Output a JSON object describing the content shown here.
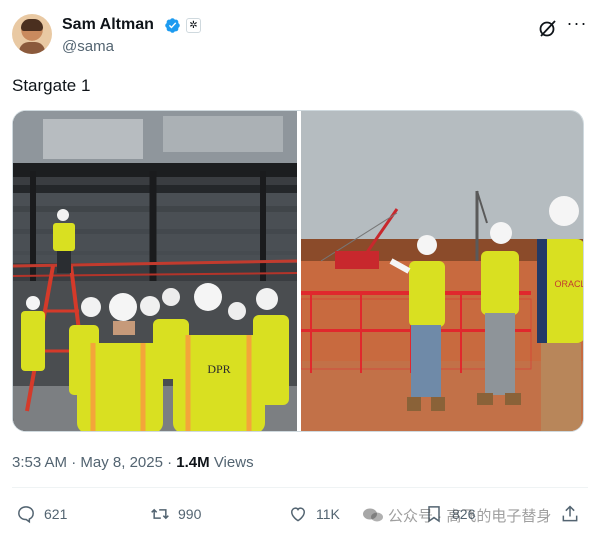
{
  "author": {
    "name": "Sam Altman",
    "handle": "@sama",
    "verified_icon": "verified-badge-icon",
    "affiliate_icon": "openai-logo-icon"
  },
  "tweet": {
    "text": "Stargate 1",
    "time": "3:53 AM",
    "date": "May 8, 2025",
    "separator": "·",
    "views_count": "1.4M",
    "views_label": "Views"
  },
  "actions": {
    "replies": "621",
    "reposts": "990",
    "likes": "11K",
    "bookmarks": "826"
  },
  "media": {
    "left_image": "construction-site-interior-photo",
    "right_image": "construction-site-exterior-photo",
    "vest_text_left": "DPR",
    "vest_text_right": "ORACLE"
  },
  "watermark": {
    "text": "公众号 · 高飞的电子替身"
  },
  "colors": {
    "accent": "#1d9bf0",
    "text_primary": "#0f1419",
    "text_secondary": "#536471",
    "vest": "#d9e021",
    "fence": "#e0282d"
  }
}
